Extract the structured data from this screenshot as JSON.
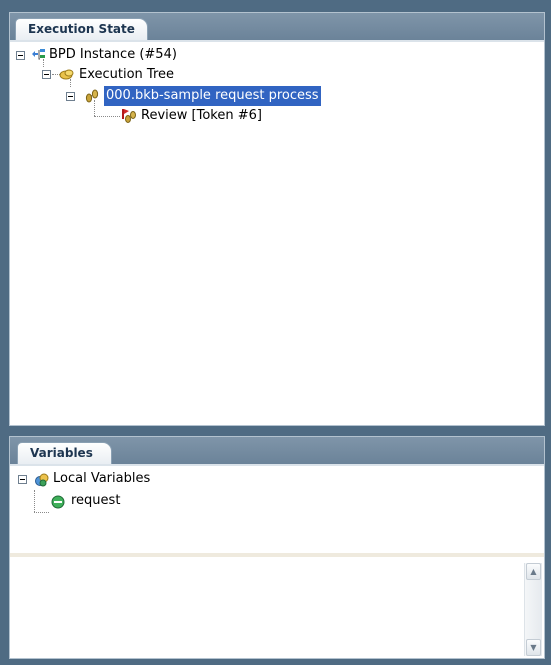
{
  "execution_panel": {
    "tab_label": "Execution State",
    "tree": {
      "root": {
        "label": "BPD Instance (#54)",
        "icon": "bpd-instance-icon"
      },
      "execution_tree": {
        "label": "Execution Tree",
        "icon": "execution-tree-icon"
      },
      "process": {
        "label": "000.bkb-sample request process",
        "icon": "footsteps-icon",
        "selected": true
      },
      "token": {
        "label": "Review [Token #6]",
        "icon": "token-icon"
      }
    }
  },
  "variables_panel": {
    "tab_label": "Variables",
    "tree": {
      "root": {
        "label": "Local Variables",
        "icon": "local-variables-icon"
      },
      "item": {
        "label": "request",
        "icon": "variable-icon"
      }
    }
  },
  "colors": {
    "frame": "#4f6b83",
    "selection": "#3164c2"
  }
}
